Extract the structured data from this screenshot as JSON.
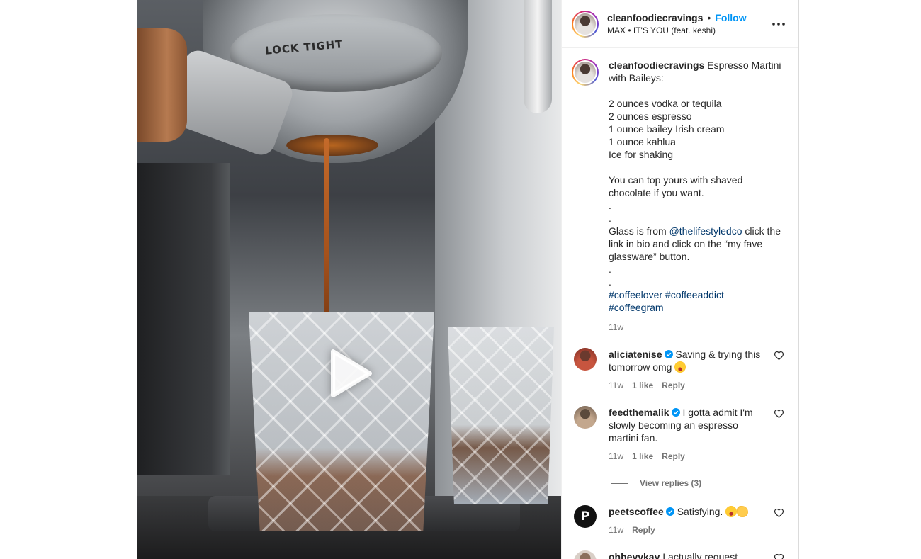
{
  "post": {
    "username": "cleanfoodiecravings",
    "follow_label": "Follow",
    "separator": "•",
    "audio": "MAX • IT'S YOU (feat. keshi)",
    "media": {
      "overlay_text": "LOCK TIGHT",
      "play_icon": "play-icon"
    }
  },
  "caption": {
    "username": "cleanfoodiecravings",
    "text_part1": "Espresso Martini with Baileys:\n\n2 ounces vodka or tequila\n2 ounces espresso\n1 ounce bailey Irish cream\n1 ounce kahlua\nIce for shaking\n\nYou can top yours with shaved chocolate if you want.\n.\n.\nGlass is from ",
    "mention": "@thelifestyledco",
    "text_part2": " click the link in bio and click on the “my fave glassware” button.\n.\n.\n",
    "hashtags": "#coffeelover #coffeeaddict #coffeegram",
    "time": "11w"
  },
  "comments": [
    {
      "username": "aliciatenise",
      "text": "Saving & trying this tomorrow omg",
      "emoji": "star-struck",
      "time": "11w",
      "likes": "1 like",
      "reply_label": "Reply"
    },
    {
      "username": "feedthemalik",
      "text": "I gotta admit I'm slowly becoming an espresso martini fan.",
      "time": "11w",
      "likes": "1 like",
      "reply_label": "Reply",
      "view_replies": "View replies (3)"
    },
    {
      "username": "peetscoffee",
      "avatar_letter": "P",
      "text": "Satisfying.",
      "emoji": [
        "star-struck",
        "clapping-hands"
      ],
      "time": "11w",
      "reply_label": "Reply"
    },
    {
      "username": "ohheyykay",
      "text": "I actually request baileys"
    }
  ],
  "colors": {
    "link_blue": "#0095f6",
    "mention_blue": "#00376b",
    "verified_blue": "#0095f6",
    "meta_gray": "#737373"
  }
}
